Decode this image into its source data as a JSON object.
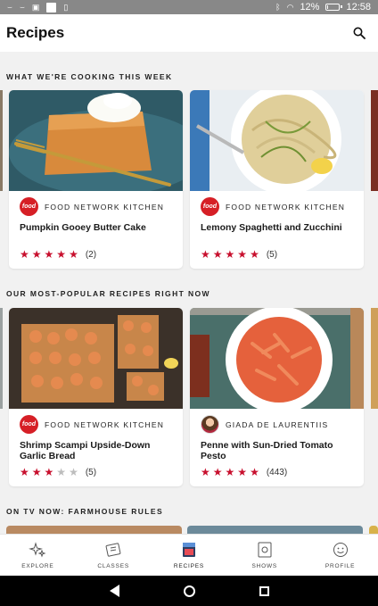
{
  "status_bar": {
    "battery": "12%",
    "battery_level": 0.12,
    "time": "12:58"
  },
  "header": {
    "title": "Recipes"
  },
  "sections": [
    {
      "title": "WHAT WE'RE COOKING THIS WEEK",
      "cards": [
        {
          "source": "FOOD NETWORK KITCHEN",
          "logo_text": "food",
          "title": "Pumpkin Gooey Butter Cake",
          "rating": 5,
          "count": "(2)"
        },
        {
          "source": "FOOD NETWORK KITCHEN",
          "logo_text": "food",
          "title": "Lemony Spaghetti and Zucchini",
          "rating": 5,
          "count": "(5)"
        }
      ]
    },
    {
      "title": "OUR MOST-POPULAR RECIPES RIGHT NOW",
      "cards": [
        {
          "source": "FOOD NETWORK KITCHEN",
          "logo_text": "food",
          "title": "Shrimp Scampi Upside-Down Garlic Bread",
          "rating": 3,
          "count": "(5)"
        },
        {
          "source": "GIADA DE LAURENTIIS",
          "title": "Penne with Sun-Dried Tomato Pesto",
          "rating": 5,
          "count": "(443)"
        }
      ]
    },
    {
      "title": "ON TV NOW: FARMHOUSE RULES"
    }
  ],
  "bottom_nav": [
    {
      "label": "EXPLORE",
      "icon": "explore-stars-icon"
    },
    {
      "label": "CLASSES",
      "icon": "classes-ticket-icon"
    },
    {
      "label": "RECIPES",
      "icon": "recipes-book-icon",
      "active": true
    },
    {
      "label": "SHOWS",
      "icon": "shows-tv-icon"
    },
    {
      "label": "PROFILE",
      "icon": "profile-face-icon"
    }
  ],
  "colors": {
    "accent": "#c8102e",
    "food_network_red": "#d61f26"
  }
}
